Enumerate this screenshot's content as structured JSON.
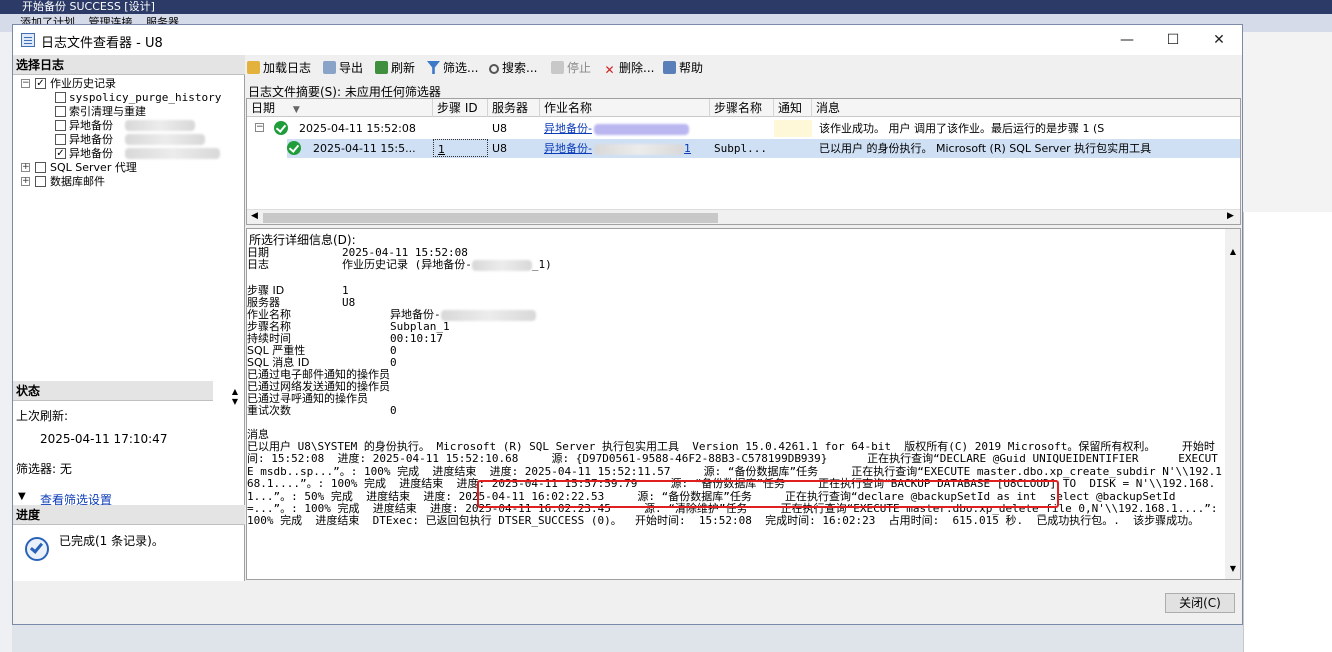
{
  "window": {
    "title": "日志文件查看器 - U8"
  },
  "left": {
    "select_header": "选择日志",
    "tree": {
      "job_history": "作业历史记录",
      "items": [
        "syspolicy_purge_history",
        "索引清理与重建",
        "异地备份",
        "异地备份",
        "异地备份"
      ],
      "sql_agent": "SQL Server 代理",
      "db_mail": "数据库邮件"
    },
    "status_header": "状态",
    "last_refresh_label": "上次刷新:",
    "last_refresh_value": "2025-04-11 17:10:47",
    "filter_label": "筛选器: 无",
    "view_filter_link": "查看筛选设置",
    "progress_header": "进度",
    "progress_text": "已完成(1 条记录)。"
  },
  "toolbar": {
    "load": "加载日志",
    "export": "导出",
    "refresh": "刷新",
    "filter": "筛选...",
    "search": "搜索...",
    "stop": "停止",
    "delete": "删除...",
    "help": "帮助"
  },
  "summary": {
    "label": "日志文件摘要(S): 未应用任何筛选器"
  },
  "grid": {
    "headers": [
      "日期",
      "步骤 ID",
      "服务器",
      "作业名称",
      "步骤名称",
      "通知",
      "消息"
    ],
    "rows": [
      {
        "date": "2025-04-11 15:52:08",
        "step_id": "",
        "server": "U8",
        "job": "异地备份-",
        "step": "",
        "notify": "",
        "message": "该作业成功。  用户   调用了该作业。最后运行的是步骤 1 (S"
      },
      {
        "date": "2025-04-11 15:5...",
        "step_id": "1",
        "server": "U8",
        "job": "异地备份-",
        "job_suffix": "1",
        "step": "Subpl...",
        "notify": "",
        "message": "已以用户         的身份执行。 Microsoft (R) SQL Server 执行包实用工具"
      }
    ]
  },
  "detail": {
    "label": "所选行详细信息(D):",
    "fields": [
      {
        "label": "日期",
        "value": "2025-04-11 15:52:08"
      },
      {
        "label": "日志",
        "value": "作业历史记录 (异地备份-",
        "value_suffix": "_1)"
      },
      {
        "label": "步骤 ID",
        "value": "1"
      },
      {
        "label": "服务器",
        "value": "U8"
      },
      {
        "label": "作业名称",
        "value": "异地备份-"
      },
      {
        "label": "步骤名称",
        "value": "Subplan_1"
      },
      {
        "label": "持续时间",
        "value": "00:10:17"
      },
      {
        "label": "SQL 严重性",
        "value": "0"
      },
      {
        "label": "SQL 消息 ID",
        "value": "0"
      },
      {
        "label": "已通过电子邮件通知的操作员",
        "value": ""
      },
      {
        "label": "已通过网络发送通知的操作员",
        "value": ""
      },
      {
        "label": "已通过寻呼通知的操作员",
        "value": ""
      },
      {
        "label": "重试次数",
        "value": "0"
      }
    ],
    "message_label": "消息",
    "message_text": "已以用户 U8\\SYSTEM 的身份执行。 Microsoft (R) SQL Server 执行包实用工具  Version 15.0.4261.1 for 64-bit  版权所有(C) 2019 Microsoft。保留所有权利。    开始时间: 15:52:08  进度: 2025-04-11 15:52:10.68     源: {D97D0561-9588-46F2-88B3-C578199DB939}      正在执行查询“DECLARE @Guid UNIQUEIDENTIFIER      EXECUTE msdb..sp...”。: 100% 完成  进度结束  进度: 2025-04-11 15:52:11.57     源: “备份数据库”任务     正在执行查询“EXECUTE master.dbo.xp_create_subdir N'\\\\192.168.1....”。: 100% 完成  进度结束  进度: 2025-04-11 15:57:59.79     源: “备份数据库”任务     正在执行查询“BACKUP DATABASE [U8CLOUD] TO  DISK = N'\\\\192.168.1...”。: 50% 完成  进度结束  进度: 2025-04-11 16:02:22.53     源: “备份数据库”任务     正在执行查询“declare @backupSetId as int  select @backupSetId =...”。: 100% 完成  进度结束  进度: 2025-04-11 16:02:23.45     源: “清除维护”任务     正在执行查询“EXECUTE master.dbo.xp_delete_file 0,N'\\\\192.168.1....”: 100% 完成  进度结束  DTExec: 已返回包执行 DTSER_SUCCESS (0)。  开始时间:  15:52:08  完成时间: 16:02:23  占用时间:  615.015 秒.  已成功执行包。.  该步骤成功。"
  },
  "close_button": "关闭(C)",
  "background": {
    "toolbar_items": [
      "添加了计划",
      "管理连接",
      "服务器"
    ],
    "title": "开始备份 SUCCESS [设计]"
  }
}
